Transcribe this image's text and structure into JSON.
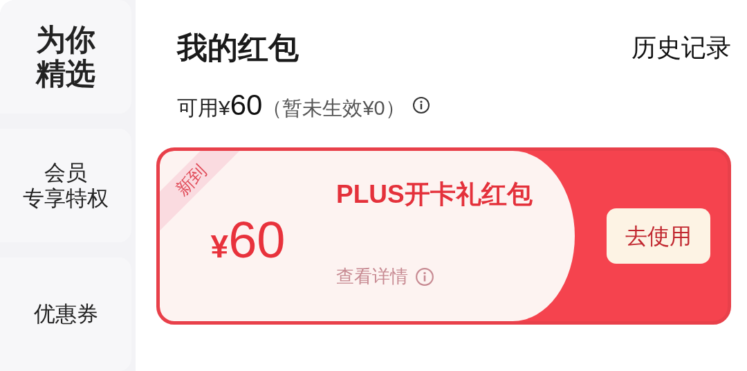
{
  "sidebar": {
    "items": [
      {
        "lines": [
          "为你",
          "精选"
        ],
        "selected": true
      },
      {
        "lines": [
          "会员",
          "专享特权"
        ],
        "selected": false
      },
      {
        "lines": [
          "优惠券"
        ],
        "selected": false
      }
    ]
  },
  "header": {
    "title": "我的红包",
    "history_link": "历史记录"
  },
  "balance": {
    "label": "可用¥",
    "amount": "60",
    "pending": "（暂未生效¥0）"
  },
  "coupons": [
    {
      "badge": "新到",
      "currency": "¥",
      "amount": "60",
      "title": "PLUS开卡礼红包",
      "details_link": "查看详情",
      "button": "去使用"
    }
  ]
}
